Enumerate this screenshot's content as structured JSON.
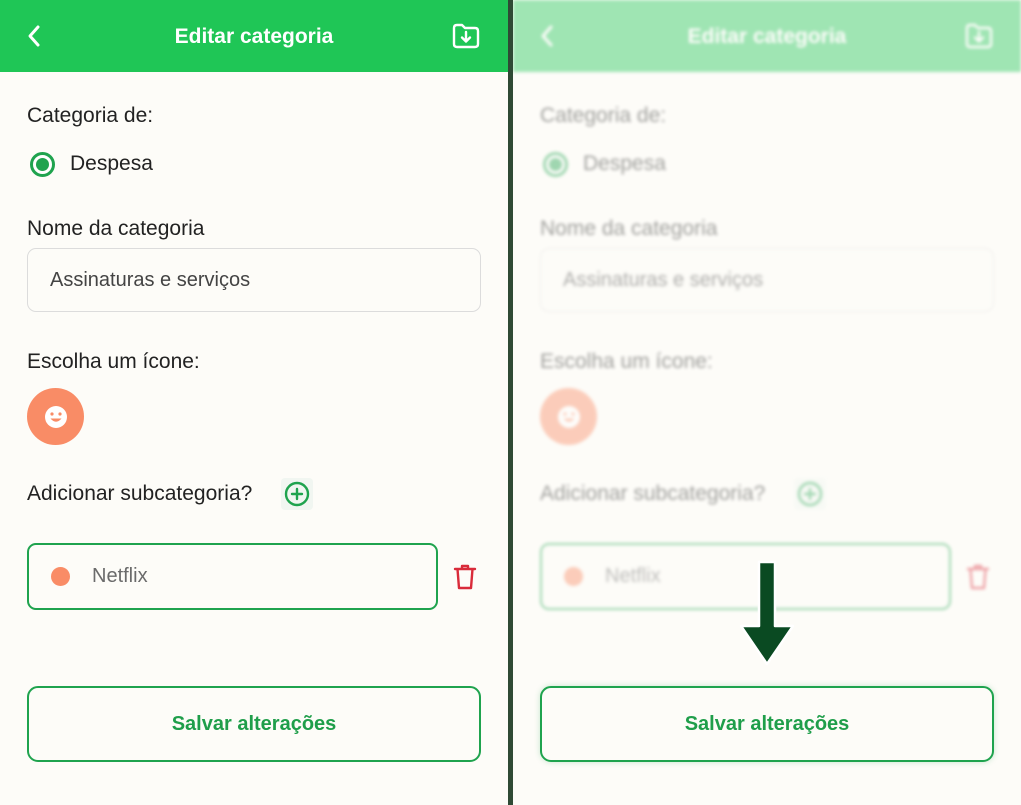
{
  "header": {
    "title": "Editar categoria",
    "back_icon": "chevron-left-icon",
    "save_icon": "folder-download-icon"
  },
  "form": {
    "category_type_label": "Categoria de:",
    "type_option": "Despesa",
    "type_selected": true,
    "name_label": "Nome da categoria",
    "name_value": "Assinaturas e serviços",
    "icon_label": "Escolha um ícone:",
    "selected_icon": "smiling-face-icon",
    "subcategory_label": "Adicionar subcategoria?",
    "subcategory_value": "Netflix",
    "save_label": "Salvar alterações"
  },
  "colors": {
    "header_green": "#1fc656",
    "accent_green": "#1fa34e",
    "icon_orange": "#f98c66",
    "delete_red": "#d92b3a",
    "arrow_green": "#0a4a22"
  }
}
